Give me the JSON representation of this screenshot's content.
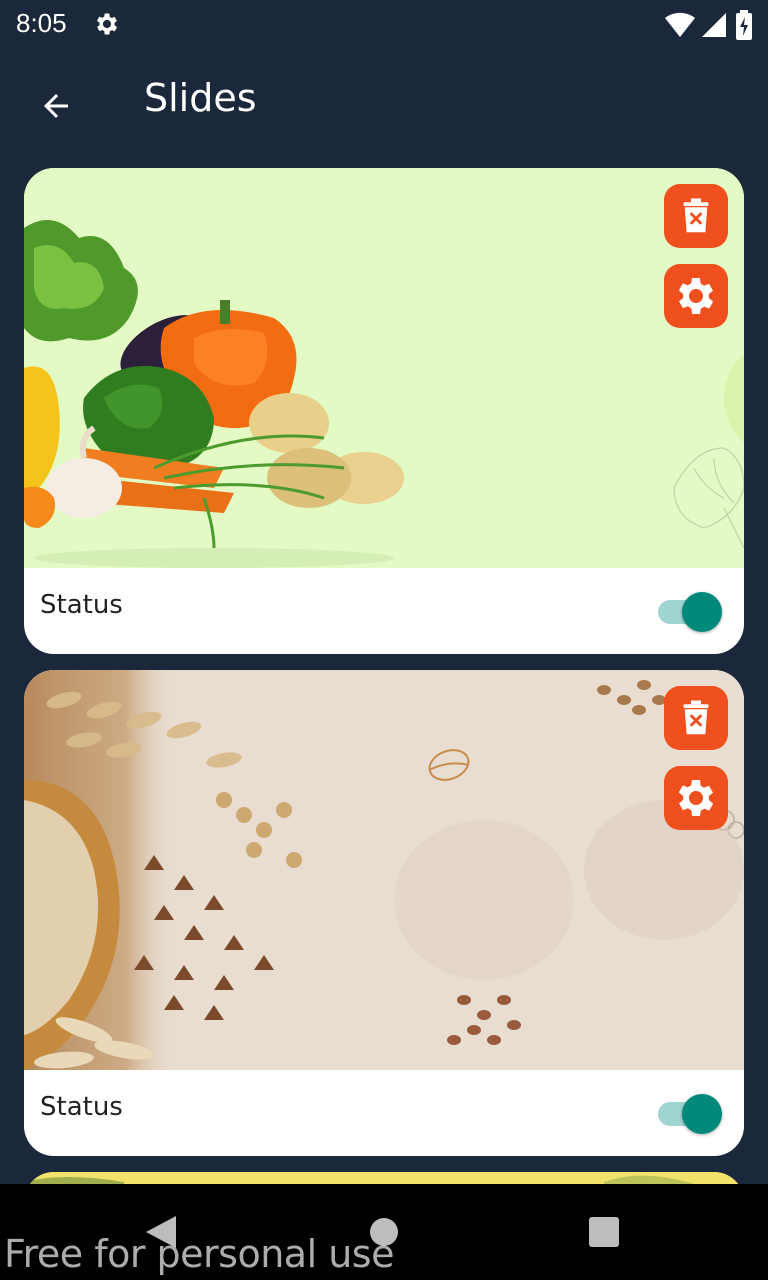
{
  "status_bar": {
    "time": "8:05"
  },
  "app_bar": {
    "title": "Slides"
  },
  "slides": [
    {
      "status_label": "Status",
      "enabled": true,
      "theme": "vegetables"
    },
    {
      "status_label": "Status",
      "enabled": true,
      "theme": "grains"
    }
  ],
  "watermark": "Free for personal use",
  "colors": {
    "background": "#1b283b",
    "action_button": "#f0501e",
    "toggle_on": "#00897b",
    "toggle_track": "#9fd5d1",
    "slide1_bg": "#e3fac4",
    "slide2_bg": "#e8ddd0",
    "slide3_bg": "#f1e36a"
  }
}
